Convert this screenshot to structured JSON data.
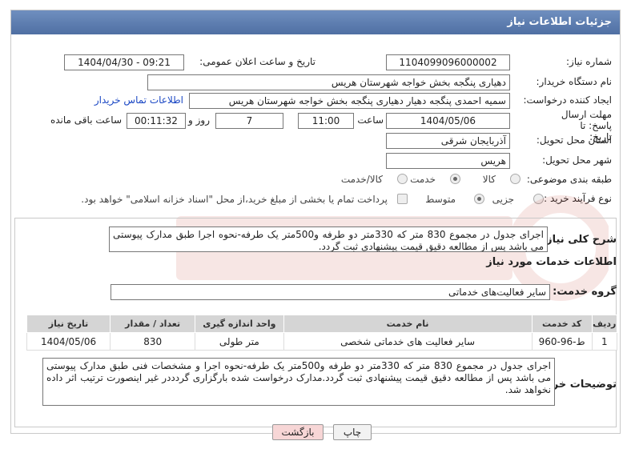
{
  "header": {
    "title": "جزئیات اطلاعات نیاز"
  },
  "fields": {
    "need_number_label": "شماره نیاز:",
    "need_number": "1104099096000002",
    "announce_label": "تاریخ و ساعت اعلان عمومی:",
    "announce_value": "1404/04/30 - 09:21",
    "buyer_label": "نام دستگاه خریدار:",
    "buyer_value": "دهیاری پنگجه بخش خواجه شهرستان هریس",
    "creator_label": "ایجاد کننده درخواست:",
    "creator_value": "سمیه احمدی پنگجه دهیار دهیاری پنگجه بخش خواجه شهرستان هریس",
    "contact_link": "اطلاعات تماس خریدار",
    "deadline_label": "مهلت ارسال پاسخ: تا تاریخ:",
    "deadline_date": "1404/05/06",
    "time_label": "ساعت",
    "deadline_time": "11:00",
    "days_value": "7",
    "days_label": "روز و",
    "remaining_time": "00:11:32",
    "remaining_label": "ساعت باقی مانده",
    "province_label": "استان محل تحویل:",
    "province_value": "آذربایجان شرقی",
    "city_label": "شهر محل تحویل:",
    "city_value": "هریس",
    "category_label": "طبقه بندی موضوعی:",
    "category_options": [
      "کالا",
      "خدمت",
      "کالا/خدمت"
    ],
    "process_label": "نوع فرآیند خرید :",
    "process_options": [
      "جزیی",
      "متوسط"
    ],
    "payment_text": "پرداخت تمام یا بخشی از مبلغ خرید،از محل \"اسناد خزانه اسلامی\" خواهد بود."
  },
  "summary": {
    "label": "شرح کلی نیاز:",
    "text": "اجرای جدول در مجموع 830 متر که 330متر دو طرفه و500متر یک طرفه-نحوه اجرا طبق مدارک پیوستی می باشد پس از مطالعه دقیق قیمت پیشنهادی ثبت گردد."
  },
  "services": {
    "title": "اطلاعات خدمات مورد نیاز",
    "group_label": "گروه خدمت:",
    "group_value": "سایر فعالیت‌های خدماتی",
    "columns": [
      "ردیف",
      "کد خدمت",
      "نام خدمت",
      "واحد اندازه گیری",
      "تعداد / مقدار",
      "تاریخ نیاز"
    ],
    "rows": [
      [
        "1",
        "ط-96-960",
        "سایر فعالیت های خدماتی شخصی",
        "متر طولی",
        "830",
        "1404/05/06"
      ]
    ]
  },
  "buyer_notes": {
    "label": "توضیحات خریدار:",
    "text": "اجرای جدول در مجموع 830 متر که 330متر دو طرفه و500متر یک طرفه-نحوه اجرا و مشخصات فنی طبق مدارک پیوستی می باشد پس از مطالعه دقیق قیمت پیشنهادی ثبت گردد.مدارک درخواست شده بارگزاری گردددر غیر اینصورت ترتیب اثر داده نخواهد شد."
  },
  "buttons": {
    "print": "چاپ",
    "back": "بازگشت"
  },
  "colors": {
    "header": "#5a7ab0",
    "back_button": "#f7d6d6",
    "link": "#1a47c4"
  }
}
